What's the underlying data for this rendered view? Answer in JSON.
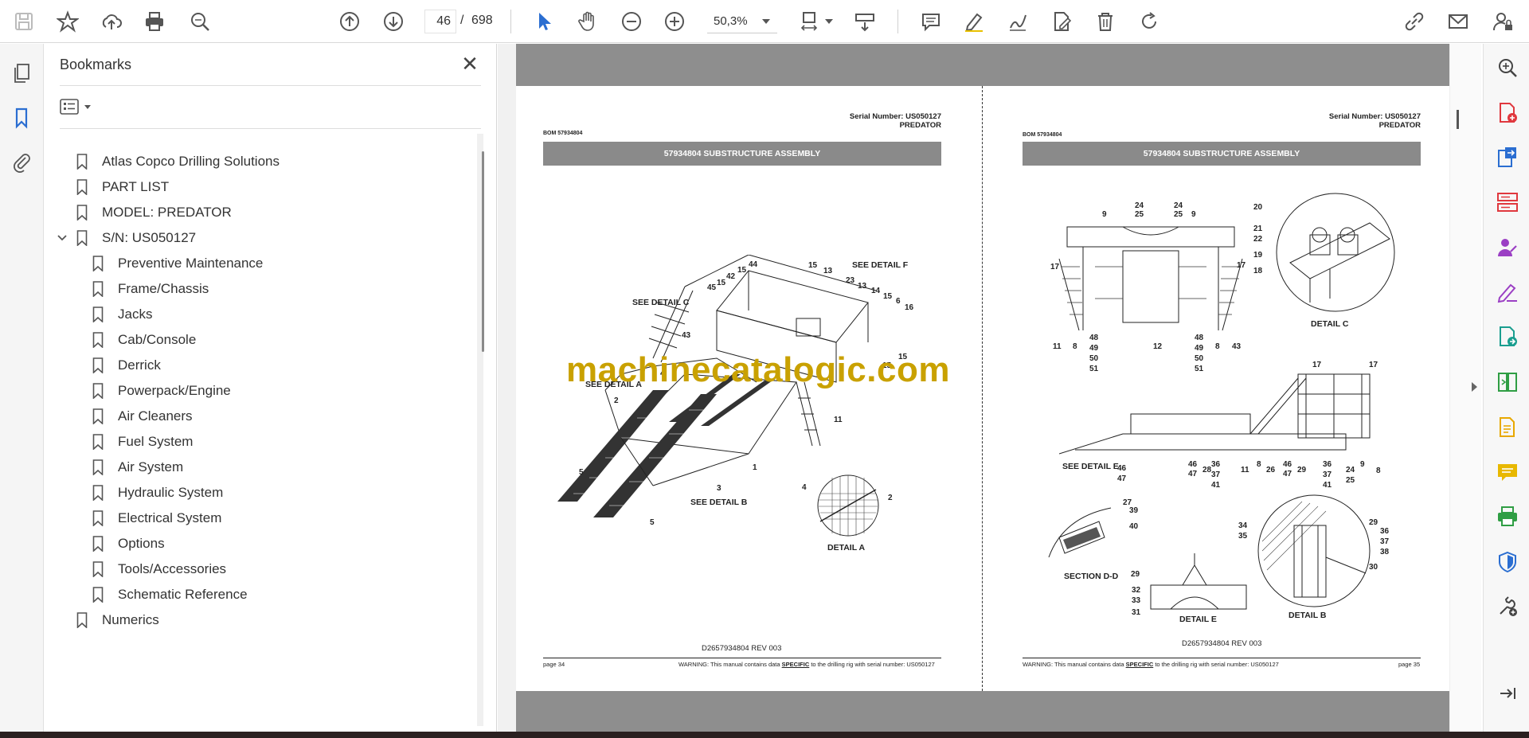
{
  "toolbar": {
    "page_current": "46",
    "page_separator": "/",
    "page_total": "698",
    "zoom": "50,3%"
  },
  "bookmarks": {
    "title": "Bookmarks",
    "close": "✕",
    "items": [
      {
        "label": "Atlas Copco Drilling Solutions"
      },
      {
        "label": "PART LIST"
      },
      {
        "label": "MODEL: PREDATOR"
      },
      {
        "label": "S/N: US050127"
      },
      {
        "label": "Preventive Maintenance"
      },
      {
        "label": "Frame/Chassis"
      },
      {
        "label": "Jacks"
      },
      {
        "label": "Cab/Console"
      },
      {
        "label": "Derrick"
      },
      {
        "label": "Powerpack/Engine"
      },
      {
        "label": "Air Cleaners"
      },
      {
        "label": "Fuel System"
      },
      {
        "label": "Air System"
      },
      {
        "label": "Hydraulic System"
      },
      {
        "label": "Electrical System"
      },
      {
        "label": "Options"
      },
      {
        "label": "Tools/Accessories"
      },
      {
        "label": "Schematic Reference"
      },
      {
        "label": "Numerics"
      }
    ]
  },
  "document": {
    "watermark": "machinecatalogic.com",
    "left_page": {
      "serial": "Serial Number: US050127",
      "model": "PREDATOR",
      "bom": "BOM 57934804",
      "assembly": "57934804 SUBSTRUCTURE ASSEMBLY",
      "doc_number": "D2657934804 REV 003",
      "page": "page 34",
      "warning_pre": "WARNING:  This manual contains data ",
      "warning_specific": "SPECIFIC",
      "warning_post": " to the drilling rig with serial number: US050127",
      "labels": {
        "see_detail_c": "SEE  DETAIL  C",
        "see_detail_f": "SEE  DETAIL  F",
        "see_detail_a": "SEE  DETAIL  A",
        "see_detail_b": "SEE  DETAIL  B",
        "detail_a": "DETAIL  A"
      }
    },
    "right_page": {
      "serial": "Serial Number: US050127",
      "model": "PREDATOR",
      "bom": "BOM 57934804",
      "assembly": "57934804 SUBSTRUCTURE ASSEMBLY",
      "doc_number": "D2657934804 REV 003",
      "page": "page 35",
      "warning_pre": "WARNING:  This manual contains data ",
      "warning_specific": "SPECIFIC",
      "warning_post": " to the drilling rig with serial number: US050127",
      "labels": {
        "detail_c": "DETAIL  C",
        "see_detail_e": "SEE  DETAIL  E",
        "section_dd": "SECTION  D-D",
        "detail_e": "DETAIL  E",
        "detail_b": "DETAIL  B"
      }
    }
  }
}
